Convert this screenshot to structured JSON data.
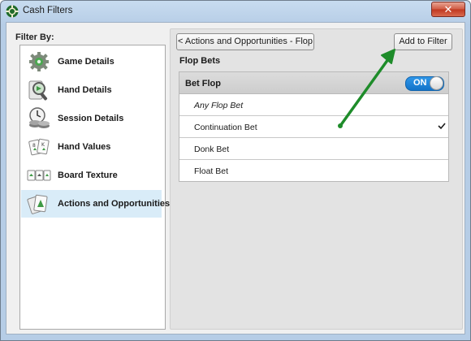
{
  "window": {
    "title": "Cash Filters",
    "close_label": "✕"
  },
  "left": {
    "filter_by_label": "Filter By:",
    "items": [
      {
        "label": "Game Details",
        "icon": "gear-icon",
        "selected": false
      },
      {
        "label": "Hand Details",
        "icon": "magnifier-icon",
        "selected": false
      },
      {
        "label": "Session Details",
        "icon": "clock-chips-icon",
        "selected": false
      },
      {
        "label": "Hand Values",
        "icon": "cards-icon",
        "selected": false
      },
      {
        "label": "Board Texture",
        "icon": "board-cards-icon",
        "selected": false
      },
      {
        "label": "Actions and Opportunities",
        "icon": "cards-arrow-icon",
        "selected": true
      }
    ]
  },
  "right": {
    "back_button": "< Actions and Opportunities - Flop",
    "add_button": "Add to Filter",
    "section_title": "Flop Bets",
    "header": {
      "label": "Bet Flop",
      "toggle": "ON"
    },
    "rows": [
      {
        "label": "Any Flop Bet",
        "italic": true,
        "checked": false
      },
      {
        "label": "Continuation Bet",
        "italic": false,
        "checked": true
      },
      {
        "label": "Donk Bet",
        "italic": false,
        "checked": false
      },
      {
        "label": "Float Bet",
        "italic": false,
        "checked": false
      }
    ]
  },
  "colors": {
    "toggle_on": "#1a7fd6",
    "selected_item": "#d9ecf8",
    "annotation_arrow": "#1e8c2a",
    "close_button": "#c8402a"
  }
}
